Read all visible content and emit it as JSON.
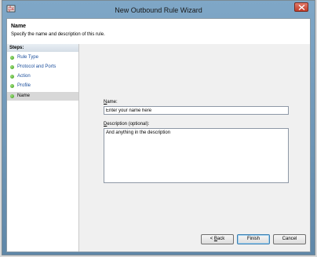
{
  "window": {
    "title": "New Outbound Rule Wizard"
  },
  "header": {
    "title": "Name",
    "subtitle": "Specify the name and description of this rule."
  },
  "steps": {
    "heading": "Steps:",
    "items": [
      {
        "label": "Rule Type",
        "active": false
      },
      {
        "label": "Protocol and Ports",
        "active": false
      },
      {
        "label": "Action",
        "active": false
      },
      {
        "label": "Profile",
        "active": false
      },
      {
        "label": "Name",
        "active": true
      }
    ]
  },
  "form": {
    "name_label_key": "N",
    "name_label_rest": "ame:",
    "name_value": "Enter your name here",
    "desc_label_key": "D",
    "desc_label_rest": "escription (optional):",
    "desc_value": "And anything in the description"
  },
  "buttons": {
    "back_prefix": "< ",
    "back_key": "B",
    "back_rest": "ack",
    "finish": "Finish",
    "cancel": "Cancel"
  }
}
